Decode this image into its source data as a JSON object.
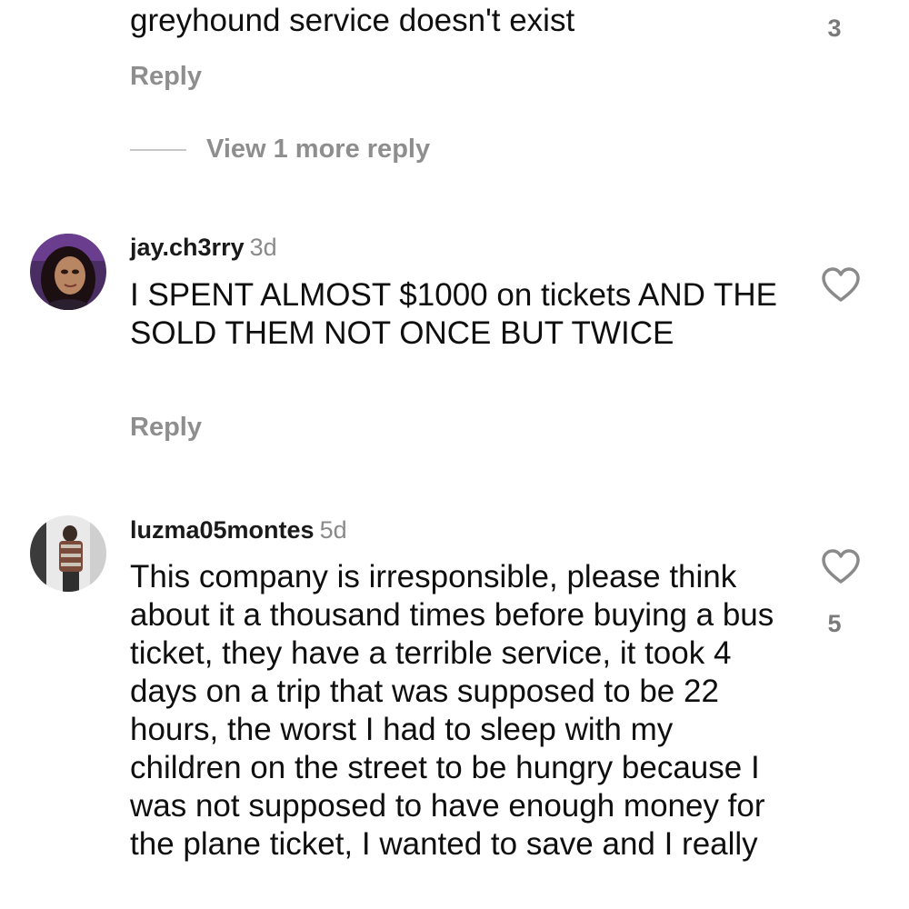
{
  "comments": [
    {
      "text": "greyhound service doesn't exist",
      "reply_label": "Reply",
      "like_count": "3"
    },
    {
      "username": "jay.ch3rry",
      "timestamp": "3d",
      "text": "I SPENT ALMOST $1000 on tickets AND THE SOLD THEM NOT ONCE BUT TWICE",
      "reply_label": "Reply"
    },
    {
      "username": "luzma05montes",
      "timestamp": "5d",
      "text": "This company is irresponsible, please think about it a thousand times before buying a bus ticket, they have a terrible service, it took 4 days on a trip that was supposed to be 22 hours, the worst I had to sleep with my children on the street to be hungry because I was not supposed to have enough money for the plane ticket, I wanted to save and I really",
      "like_count": "5"
    }
  ],
  "view_more_replies": "View 1 more reply",
  "icons": {
    "like": "heart-icon"
  }
}
